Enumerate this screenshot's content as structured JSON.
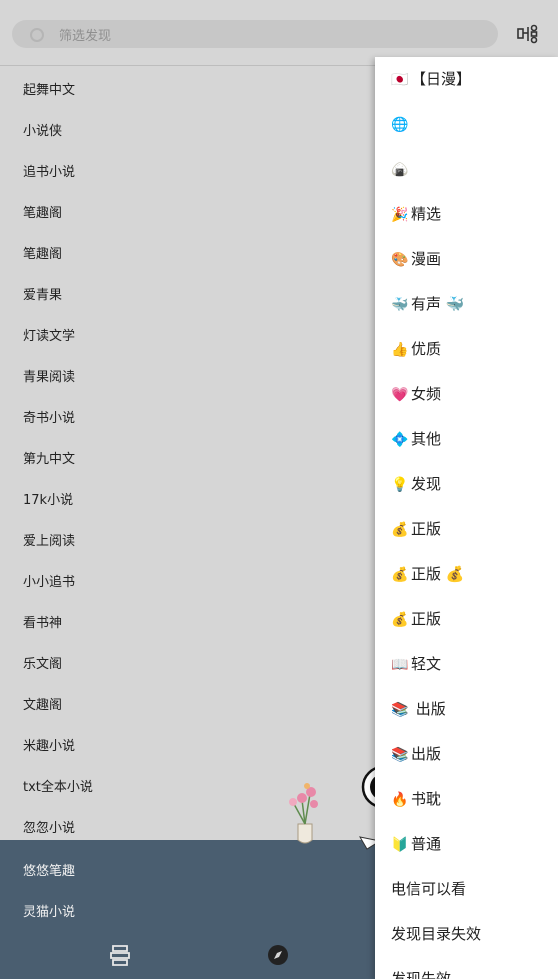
{
  "search": {
    "placeholder": "筛选发现"
  },
  "icons": {
    "search": "search-icon",
    "group": "group-icon",
    "bookshelf": "bookshelf-icon",
    "explore": "compass-icon"
  },
  "sources": [
    "起舞中文",
    "小说侠",
    "追书小说",
    "笔趣阁",
    "笔趣阁",
    "爱青果",
    "灯读文学",
    "青果阅读",
    "奇书小说",
    "第九中文",
    "17k小说",
    "爱上阅读",
    "小小追书",
    "看书神",
    "乐文阁",
    "文趣阁",
    "米趣小说",
    "txt全本小说",
    "忽忽小说"
  ],
  "bottom_sources": [
    "悠悠笔趣",
    "灵猫小说"
  ],
  "menu": [
    {
      "emoji": "🇯🇵",
      "label": "【日漫】"
    },
    {
      "emoji": "🌐",
      "label": ""
    },
    {
      "emoji": "🍙",
      "label": ""
    },
    {
      "emoji": "🎉",
      "label": "精选"
    },
    {
      "emoji": "🎨",
      "label": "漫画"
    },
    {
      "emoji": "🐳",
      "label": "有声 🐳"
    },
    {
      "emoji": "👍",
      "label": "优质"
    },
    {
      "emoji": "💗",
      "label": "女频"
    },
    {
      "emoji": "💠",
      "label": "其他"
    },
    {
      "emoji": "💡",
      "label": "发现"
    },
    {
      "emoji": "💰",
      "label": "正版"
    },
    {
      "emoji": "💰",
      "label": "正版 💰"
    },
    {
      "emoji": "💰",
      "label": "正版"
    },
    {
      "emoji": "📖",
      "label": "轻文"
    },
    {
      "emoji": "📚",
      "label": " 出版"
    },
    {
      "emoji": "📚",
      "label": "出版"
    },
    {
      "emoji": "🔥",
      "label": "书耽"
    },
    {
      "emoji": "🔰",
      "label": "普通"
    },
    {
      "emoji": "",
      "label": "电信可以看"
    },
    {
      "emoji": "",
      "label": "发现目录失效"
    },
    {
      "emoji": "",
      "label": "发现失效"
    }
  ]
}
